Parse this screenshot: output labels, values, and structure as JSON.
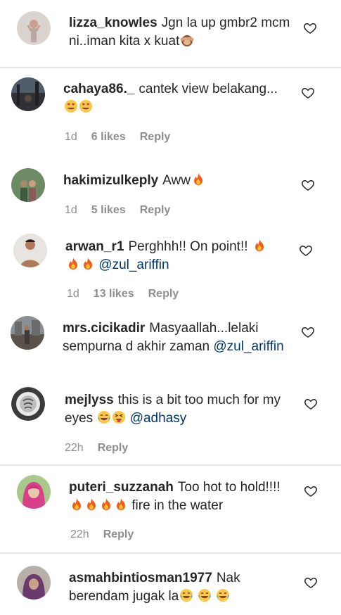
{
  "comments": [
    {
      "username": "lizza_knowles",
      "text": "Jgn la up gmbr2 mcm ni..iman kita x kuat",
      "time": "",
      "likes": "",
      "reply": "",
      "avatar_colors": [
        "#d9d4cf",
        "#b9a9a0"
      ]
    },
    {
      "username": "cahaya86._",
      "text": "cantek view belakang...",
      "time": "1d",
      "likes": "6 likes",
      "reply": "Reply",
      "avatar_colors": [
        "#4f5d6b",
        "#2f3136"
      ]
    },
    {
      "username": "hakimizulkeply",
      "text": "Aww",
      "time": "1d",
      "likes": "5 likes",
      "reply": "Reply",
      "avatar_colors": [
        "#6c8a63",
        "#a88a6c"
      ]
    },
    {
      "username": "arwan_r1",
      "text": "Perghhh!! On point!!",
      "mention": "@zul_ariffin",
      "time": "1d",
      "likes": "13 likes",
      "reply": "Reply",
      "avatar_colors": [
        "#e8e4df",
        "#b07a5a"
      ]
    },
    {
      "username": "mrs.cicikadir",
      "text": "Masyaallah...lelaki sempurna d akhir zaman",
      "mention": "@zul_ariffin",
      "time": "",
      "likes": "",
      "reply": "",
      "avatar_colors": [
        "#8a8f95",
        "#3d3a38"
      ]
    },
    {
      "username": "mejlyss",
      "text": "this is a bit too much for my eyes",
      "mention": "@adhasy",
      "time": "22h",
      "likes": "",
      "reply": "Reply",
      "avatar_colors": [
        "#3b3b3b",
        "#e8e8e8"
      ]
    },
    {
      "username": "puteri_suzzanah",
      "text": "Too hot to hold!!!!",
      "text_after": "fire in the water",
      "time": "22h",
      "likes": "",
      "reply": "Reply",
      "avatar_colors": [
        "#d9408a",
        "#e8c9a9"
      ]
    },
    {
      "username": "asmahbintiosman1977",
      "text": "Nak berendam jugak la",
      "time": "",
      "likes": "",
      "reply": "",
      "avatar_colors": [
        "#6b3a6b",
        "#c9a08a"
      ]
    }
  ],
  "icons": {
    "like": "heart-outline-icon",
    "emoji_monkey": "see-no-evil-monkey-emoji",
    "emoji_heart_eyes": "heart-eyes-emoji",
    "emoji_fire": "fire-emoji",
    "emoji_laugh": "tears-of-joy-emoji",
    "emoji_squint": "squinting-tongue-emoji"
  },
  "colors": {
    "text": "#262626",
    "secondary": "#8e8e8e",
    "mention": "#00376b",
    "divider": "#e6e6e6"
  }
}
